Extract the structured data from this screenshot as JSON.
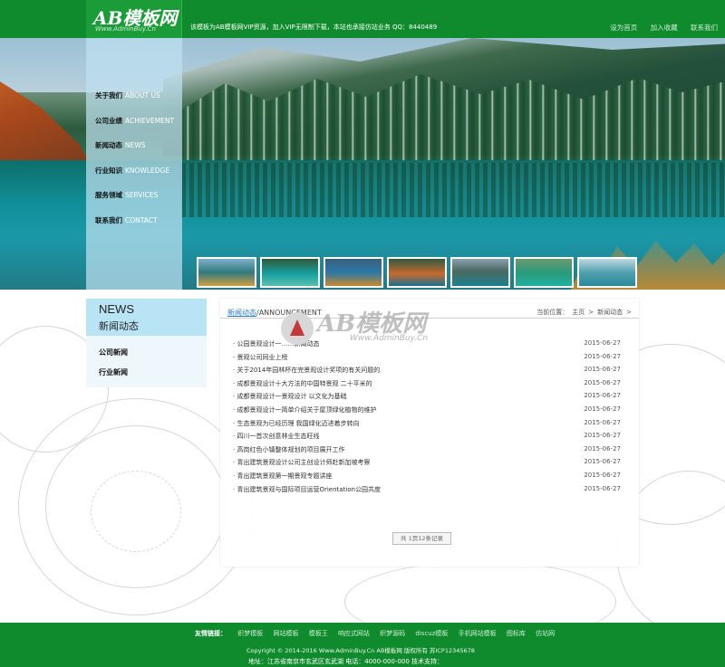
{
  "header": {
    "logo_text": "AB模板网",
    "logo_sub": "Www.AdminBuy.Cn",
    "notice": "该模板为AB模板网VIP资源，加入VIP无限制下载，本站也承接仿站业务 QQ：8440489",
    "links": [
      "设为首页",
      "加入收藏",
      "联系我们"
    ]
  },
  "nav": {
    "items": [
      {
        "cn": "关于我们",
        "en": "ABOUT US"
      },
      {
        "cn": "公司业绩",
        "en": "ACHIEVEMENT"
      },
      {
        "cn": "新闻动态",
        "en": "NEWS"
      },
      {
        "cn": "行业知识",
        "en": "KNOWLEDGE"
      },
      {
        "cn": "服务领域",
        "en": "SERVICES"
      },
      {
        "cn": "联系我们",
        "en": "CONTACT"
      }
    ]
  },
  "sidebar": {
    "title_en": "NEWS",
    "title_cn": "新闻动态",
    "categories": [
      "公司新闻",
      "行业新闻"
    ]
  },
  "content": {
    "title_cn": "新闻动态",
    "title_en": "/ANNOUNCEMENT",
    "breadcrumb": [
      "当前位置：",
      "主页",
      ">",
      "新闻动态",
      ">"
    ],
    "news": [
      {
        "title": "· 公园景观设计一……新闻动态",
        "date": "2015-06-27"
      },
      {
        "title": "· 景观公司同业上榜",
        "date": "2015-06-27"
      },
      {
        "title": "· 关于2014年园林杯在完景观设计奖项的有关问题的",
        "date": "2015-06-27"
      },
      {
        "title": "· 成都景观设计十大方法的中国特景观 二十平米的",
        "date": "2015-06-27"
      },
      {
        "title": "· 成都景观设计一景观设计 以文化为基础",
        "date": "2015-06-27"
      },
      {
        "title": "· 成都景观设计一简单介绍关于屋顶绿化植物的维护",
        "date": "2015-06-27"
      },
      {
        "title": "· 生态景观为已经历理 我国绿化迈进着步转向",
        "date": "2015-06-27"
      },
      {
        "title": "· 四川一首次创意林业生态旺线",
        "date": "2015-06-27"
      },
      {
        "title": "· 高岗红色小镇整体规划的项目展开工作",
        "date": "2015-06-27"
      },
      {
        "title": "· 青出建筑景观设计公司主创设计师赴新加坡考察",
        "date": "2015-06-27"
      },
      {
        "title": "· 青出建筑景观第一期景观专题讲座",
        "date": "2015-06-27"
      },
      {
        "title": "· 青出建筑景观与国际项目运营Orientation公园共度",
        "date": "2015-06-27"
      }
    ],
    "pager": "共 1页12条记录",
    "watermark": "AB模板网",
    "watermark_sub": "Www.AdminBuy.Cn"
  },
  "footer": {
    "links_label": "友情链接：",
    "links": [
      "织梦模板",
      "网站模板",
      "模板王",
      "响应式网站",
      "织梦源码",
      "discuz模板",
      "手机网站模板",
      "图标库",
      "仿站网"
    ],
    "copyright": "Copyright © 2014-2016 Www.AdminBuy.Cn AB模板网 版权所有 苏ICP12345678",
    "address": "地址：江苏省南京市玄武区玄武湖 电话：4000-000-000 技术支持："
  },
  "colors": {
    "brand_green": "#0f8a2c",
    "nav_panel": "#bee1f0",
    "news_head": "#b9e4f5",
    "link_blue": "#2d7bd0"
  }
}
